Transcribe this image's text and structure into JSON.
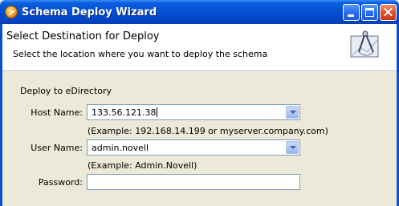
{
  "window": {
    "title": "Schema Deploy Wizard"
  },
  "banner": {
    "title": "Select Destination for Deploy",
    "description": "Select the location where you want to deploy the schema"
  },
  "form": {
    "group_label": "Deploy to eDirectory",
    "host": {
      "label": "Host Name:",
      "value": "133.56.121.38",
      "example": "(Example: 192.168.14.199 or myserver.company.com)"
    },
    "user": {
      "label": "User Name:",
      "value": "admin.novell",
      "example": "(Example:  Admin.Novell)"
    },
    "password": {
      "label": "Password:",
      "value": ""
    }
  },
  "icons": {
    "app": "wizard-app-icon",
    "banner": "drafting-compass-icon",
    "minimize": "minimize-icon",
    "maximize": "maximize-icon",
    "close": "close-icon",
    "dropdown": "chevron-down-icon"
  }
}
